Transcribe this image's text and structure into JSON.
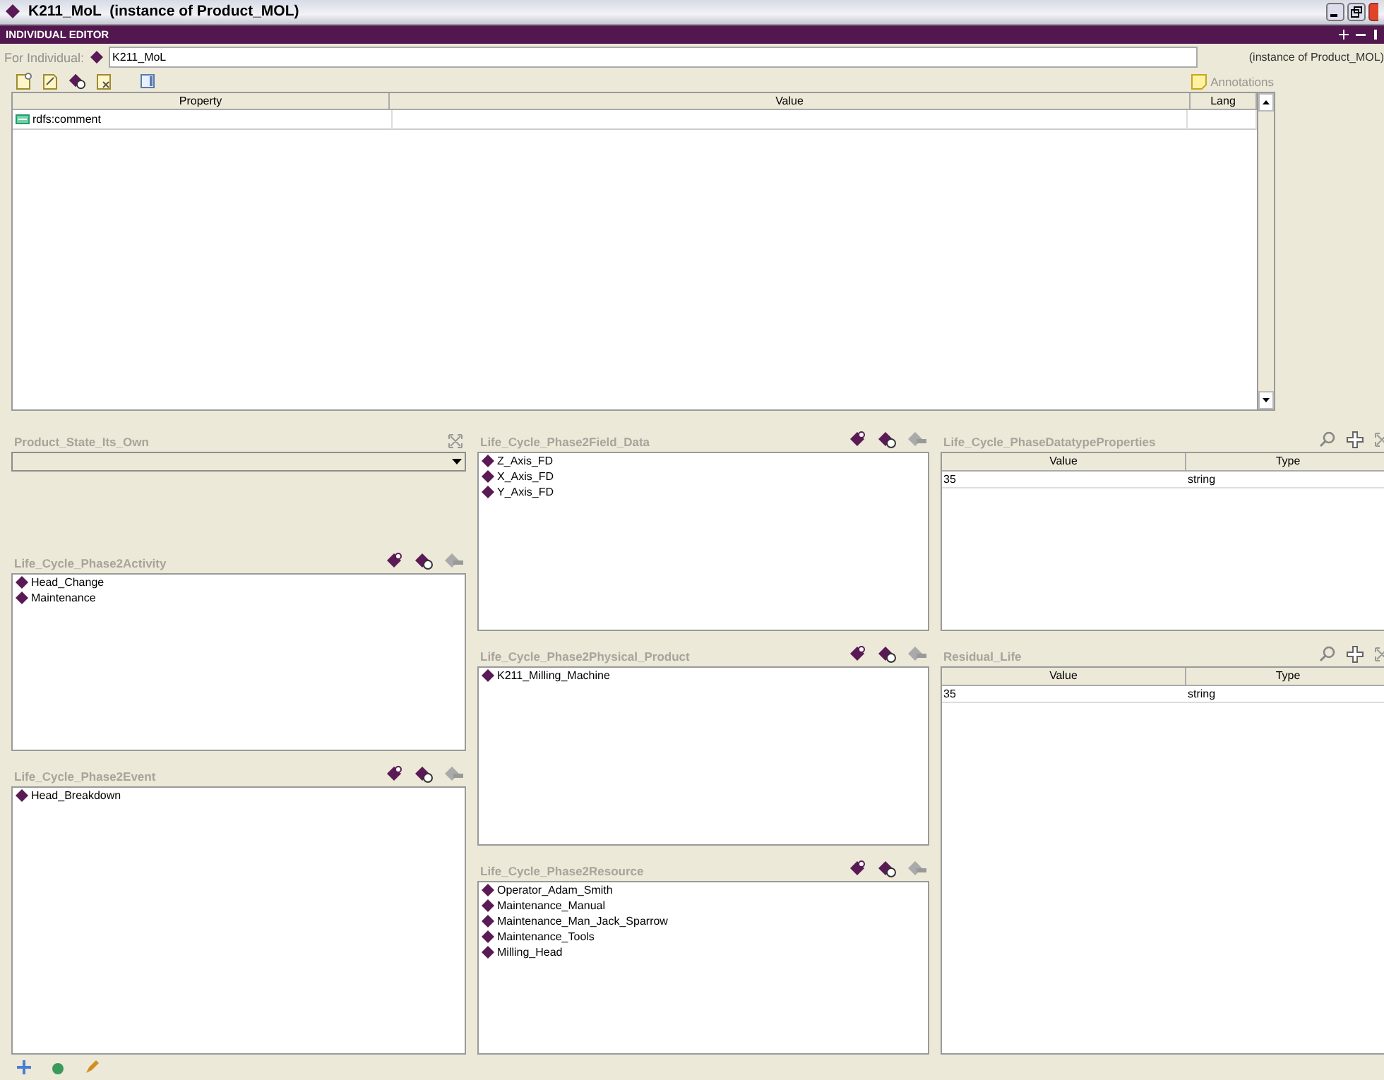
{
  "window": {
    "title": "K211_MoL  (instance of Product_MOL)"
  },
  "editor": {
    "title": "INDIVIDUAL EDITOR",
    "for_label": "For Individual:",
    "individual": "K211_MoL",
    "instance_of": "(instance of Product_MOL)",
    "annotations_label": "Annotations",
    "table": {
      "columns": [
        "Property",
        "Value",
        "Lang"
      ],
      "rows": [
        {
          "property": "rdfs:comment"
        }
      ]
    }
  },
  "columns": [
    {
      "panels": [
        {
          "kind": "combo",
          "title": "Product_State_Its_Own"
        },
        {
          "kind": "list",
          "title": "Life_Cycle_Phase2Activity",
          "items": [
            "Head_Change",
            "Maintenance"
          ]
        },
        {
          "kind": "list",
          "title": "Life_Cycle_Phase2Event",
          "items": [
            "Head_Breakdown"
          ]
        }
      ]
    },
    {
      "panels": [
        {
          "kind": "list",
          "title": "Life_Cycle_Phase2Field_Data",
          "items": [
            "Z_Axis_FD",
            "X_Axis_FD",
            "Y_Axis_FD"
          ]
        },
        {
          "kind": "list",
          "title": "Life_Cycle_Phase2Physical_Product",
          "items": [
            "K211_Milling_Machine"
          ]
        },
        {
          "kind": "list",
          "title": "Life_Cycle_Phase2Resource",
          "items": [
            "Operator_Adam_Smith",
            "Maintenance_Manual",
            "Maintenance_Man_Jack_Sparrow",
            "Maintenance_Tools",
            "Milling_Head"
          ]
        }
      ]
    },
    {
      "panels": [
        {
          "kind": "table",
          "title": "Life_Cycle_PhaseDatatypeProperties",
          "columns": [
            "Value",
            "Type"
          ],
          "rows": [
            {
              "value": "35",
              "type": "string"
            }
          ]
        },
        {
          "kind": "table",
          "title": "Residual_Life",
          "columns": [
            "Value",
            "Type"
          ],
          "rows": [
            {
              "value": "35",
              "type": "string"
            }
          ]
        }
      ]
    }
  ]
}
